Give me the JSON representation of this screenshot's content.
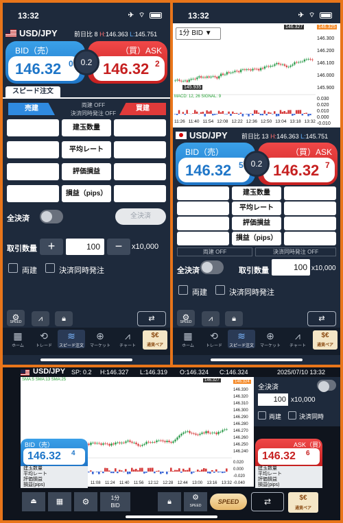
{
  "left_screen": {
    "status": {
      "time": "13:32"
    },
    "pair": "USD/JPY",
    "prev_label": "前日比",
    "prev_value": "8",
    "high_label": "H:",
    "high_value": "146.363",
    "low_label": "L:",
    "low_value": "145.751",
    "bid_label": "BID（売）",
    "bid_price_main": "146.32",
    "bid_price_sup": "0",
    "ask_label": "（買）ASK",
    "ask_price_main": "146.32",
    "ask_price_sup": "2",
    "spread": "0.2",
    "speed_order_tab": "スピード注文",
    "sell_tab": "売建",
    "buy_tab": "買建",
    "ryodate": "両建 OFF",
    "dojihachu": "決済同時発注 OFF",
    "rows": [
      "建玉数量",
      "平均レート",
      "評価損益",
      "損益（pips）"
    ],
    "zenkessai_label": "全決済",
    "zenkessai_button": "全決済",
    "qty_label": "取引数量",
    "qty_value": "100",
    "qty_unit": "x10,000",
    "ryodate_check": "両建",
    "kessai_check": "決済同時発注",
    "speed_label": "SPEED",
    "nav": [
      "ホーム",
      "トレード",
      "スピード注文",
      "マーケット",
      "チャート",
      "通貨ペア"
    ]
  },
  "right_screen": {
    "status": {
      "time": "13:32"
    },
    "timeframe": "1分 BID",
    "price_tag_top": "146.325",
    "price_tag_mid": "146.327",
    "price_tag_low": "145.935",
    "y_ticks": [
      "146.325",
      "146.300",
      "146.200",
      "146.100",
      "146.000",
      "145.900"
    ],
    "macd_label": "MACD: 12, 26  SIGNAL: 9",
    "macd_ticks": [
      "0.030",
      "0.020",
      "0.010",
      "0.000",
      "-0.010"
    ],
    "x_ticks": [
      "11:26",
      "11:40",
      "11:54",
      "12:08",
      "12:22",
      "12:36",
      "12:50",
      "13:04",
      "13:18",
      "13:32"
    ],
    "pair": "USD/JPY",
    "prev_label": "前日比",
    "prev_value": "13",
    "high_label": "H:",
    "high_value": "146.363",
    "low_label": "L:",
    "low_value": "145.751",
    "bid_label": "BID（売）",
    "bid_price_main": "146.32",
    "bid_price_sup": "5",
    "ask_label": "（買）ASK",
    "ask_price_main": "146.32",
    "ask_price_sup": "7",
    "spread": "0.2",
    "rows": [
      "建玉数量",
      "平均レート",
      "評価損益",
      "損益（pips）"
    ],
    "ryodate": "両建 OFF",
    "dojihachu": "決済同時発注 OFF",
    "zenkessai_label": "全決済",
    "qty_label": "取引数量",
    "qty_value": "100",
    "qty_unit": "x10,000",
    "ryodate_check": "両建",
    "kessai_check": "決済同時発注",
    "speed_label": "SPEED",
    "nav": [
      "ホーム",
      "トレード",
      "スピード注文",
      "マーケット",
      "チャート",
      "通貨ペア"
    ]
  },
  "landscape": {
    "pair": "USD/JPY",
    "sp_label": "SP:",
    "sp_value": "0.2",
    "h_label": "H:",
    "h_value": "146.327",
    "l_label": "L:",
    "l_value": "146.319",
    "o_label": "O:",
    "o_value": "146.324",
    "c_label": "C:",
    "c_value": "146.324",
    "datetime": "2025/07/10 13:32",
    "ma_legend": [
      "SMA:5",
      "SMA:13",
      "SMA:25"
    ],
    "price_tag_1": "146.327",
    "price_tag_2": "146.324",
    "y_ticks": [
      "146.330",
      "146.320",
      "146.310",
      "146.300",
      "146.290",
      "146.280",
      "146.270",
      "146.260",
      "146.250",
      "146.240"
    ],
    "macd_ticks": [
      "0.020",
      "0.000",
      "-0.020",
      "-0.040"
    ],
    "x_ticks": [
      "11:08",
      "11:24",
      "11:40",
      "11:56",
      "12:12",
      "12:28",
      "12:44",
      "13:00",
      "13:16",
      "13:32"
    ],
    "zenkessai_label": "全決済",
    "qty_value": "100",
    "qty_unit": "x10,000",
    "ryodate_check": "両建",
    "kessai_check": "決済同時",
    "bid_label": "BID（売）",
    "bid_price_main": "146.32",
    "bid_price_sup": "4",
    "ask_label": "ASK（買）",
    "ask_price_main": "146.32",
    "ask_price_sup": "6",
    "rows": [
      "建玉数量",
      "平均レート",
      "評価損益",
      "損益(pips)"
    ],
    "tf_button": "1分",
    "tf_sub": "BID",
    "speed_label": "SPEED",
    "ccy_label": "通貨ペア"
  },
  "colors": {
    "bid": "#1f76c8",
    "ask": "#c62020",
    "frame": "#e8751a",
    "panel": "#1e2a3c"
  }
}
